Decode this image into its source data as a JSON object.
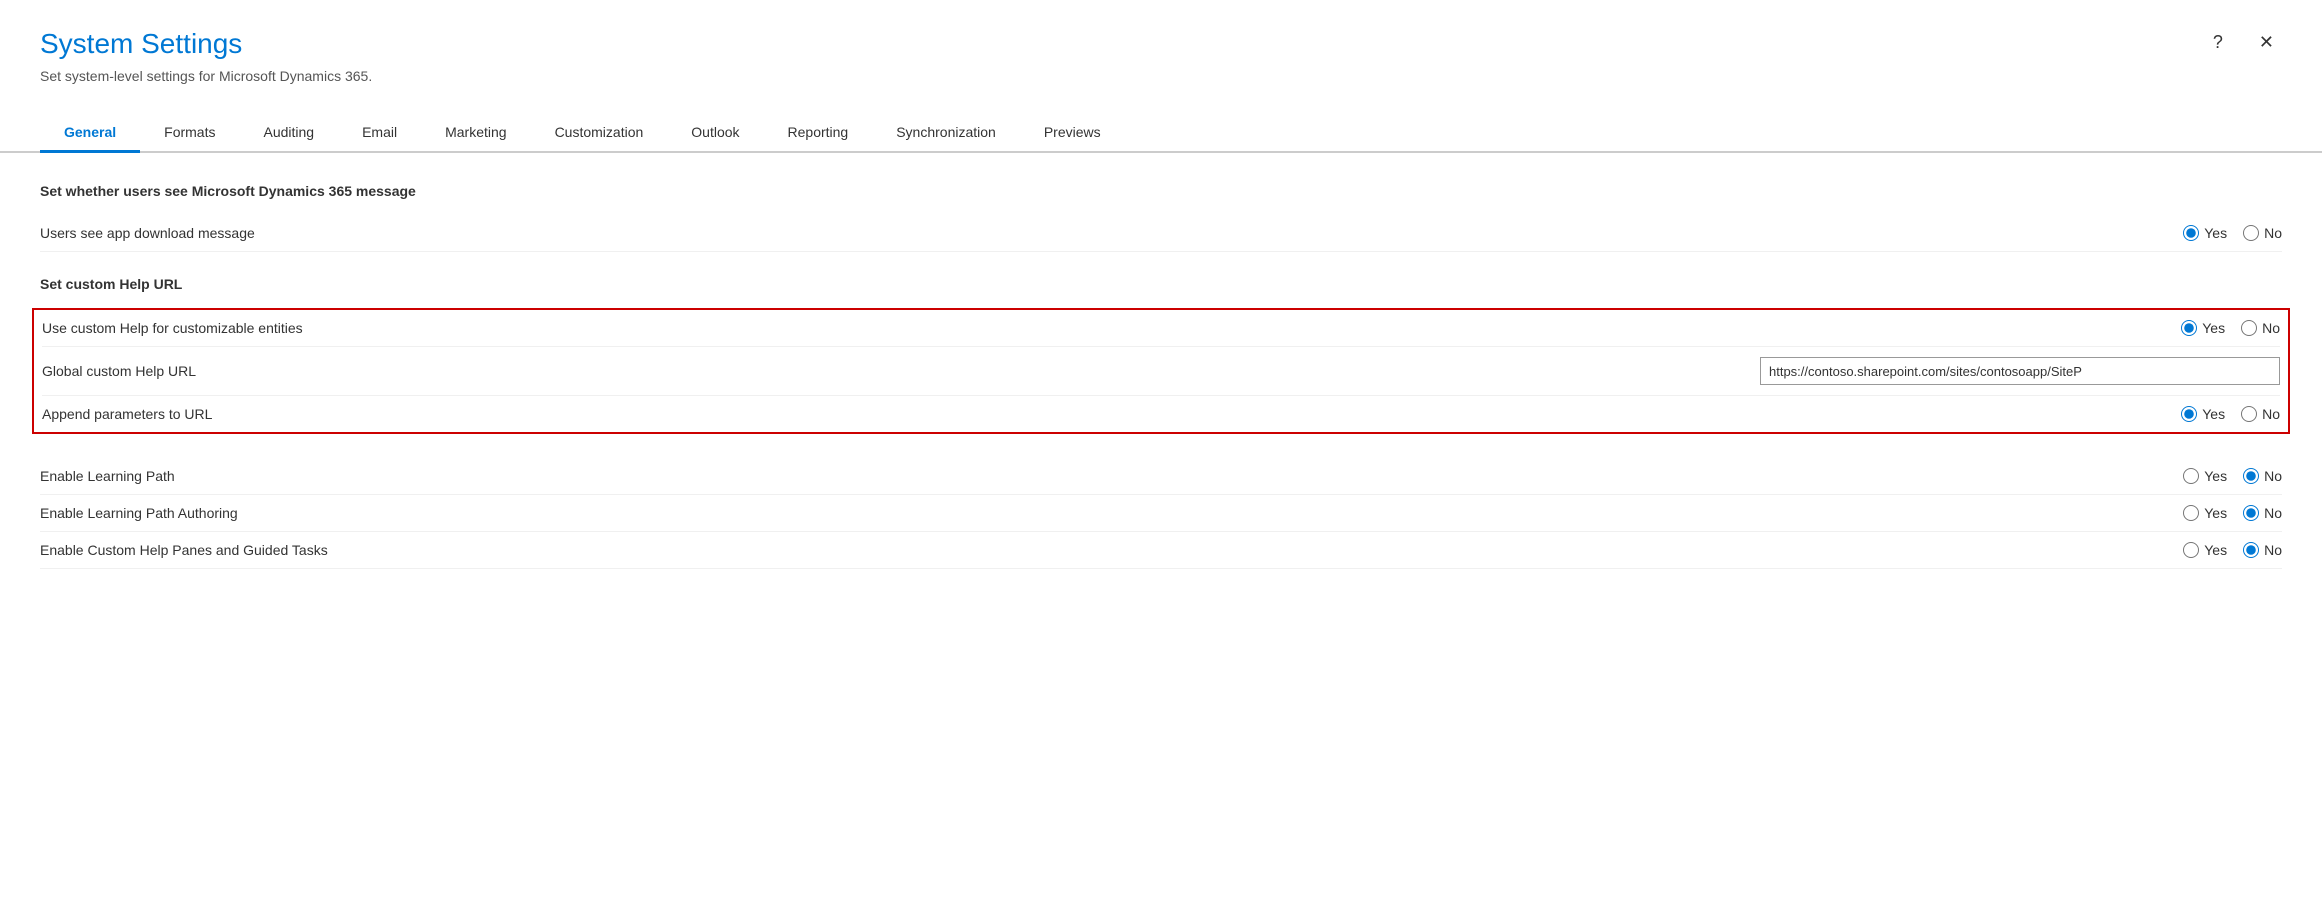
{
  "dialog": {
    "title": "System Settings",
    "subtitle": "Set system-level settings for Microsoft Dynamics 365.",
    "help_btn": "?",
    "close_btn": "✕"
  },
  "tabs": [
    {
      "id": "general",
      "label": "General",
      "active": true
    },
    {
      "id": "formats",
      "label": "Formats",
      "active": false
    },
    {
      "id": "auditing",
      "label": "Auditing",
      "active": false
    },
    {
      "id": "email",
      "label": "Email",
      "active": false
    },
    {
      "id": "marketing",
      "label": "Marketing",
      "active": false
    },
    {
      "id": "customization",
      "label": "Customization",
      "active": false
    },
    {
      "id": "outlook",
      "label": "Outlook",
      "active": false
    },
    {
      "id": "reporting",
      "label": "Reporting",
      "active": false
    },
    {
      "id": "synchronization",
      "label": "Synchronization",
      "active": false
    },
    {
      "id": "previews",
      "label": "Previews",
      "active": false
    }
  ],
  "sections": [
    {
      "id": "ms-message-section",
      "title": "Set whether users see Microsoft Dynamics 365 message",
      "rows": [
        {
          "id": "app-download-message",
          "label": "Users see app download message",
          "control": "radio",
          "value": "yes",
          "options": [
            "Yes",
            "No"
          ]
        }
      ]
    },
    {
      "id": "custom-help-section",
      "title": "Set custom Help URL",
      "highlighted": true,
      "rows": [
        {
          "id": "custom-help-entities",
          "label": "Use custom Help for customizable entities",
          "control": "radio",
          "value": "yes",
          "options": [
            "Yes",
            "No"
          ]
        },
        {
          "id": "global-help-url",
          "label": "Global custom Help URL",
          "control": "input",
          "value": "https://contoso.sharepoint.com/sites/contosoapp/SiteP"
        },
        {
          "id": "append-params",
          "label": "Append parameters to URL",
          "control": "radio",
          "value": "yes",
          "options": [
            "Yes",
            "No"
          ]
        }
      ]
    },
    {
      "id": "learning-section",
      "title": "",
      "highlighted": false,
      "rows": [
        {
          "id": "enable-learning-path",
          "label": "Enable Learning Path",
          "control": "radio",
          "value": "no",
          "options": [
            "Yes",
            "No"
          ]
        },
        {
          "id": "enable-learning-path-authoring",
          "label": "Enable Learning Path Authoring",
          "control": "radio",
          "value": "no",
          "options": [
            "Yes",
            "No"
          ]
        },
        {
          "id": "enable-custom-help-panes",
          "label": "Enable Custom Help Panes and Guided Tasks",
          "control": "radio",
          "value": "no",
          "options": [
            "Yes",
            "No"
          ]
        }
      ]
    }
  ]
}
